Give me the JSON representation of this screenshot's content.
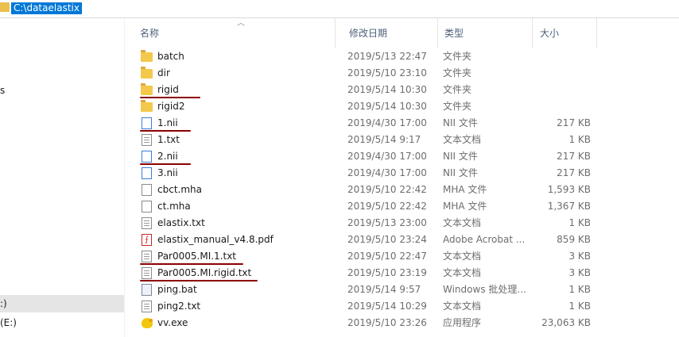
{
  "address": {
    "path": "C:\\dataelastix"
  },
  "nav": {
    "items": [
      {
        "label": "s",
        "state": "normal"
      },
      {
        "label": ":)",
        "state": "hover"
      },
      {
        "label": "(E:)",
        "state": "normal"
      }
    ]
  },
  "columns": {
    "name": "名称",
    "date": "修改日期",
    "type": "类型",
    "size": "大小"
  },
  "files": [
    {
      "name": "batch",
      "date": "2019/5/13 22:47",
      "type": "文件夹",
      "size": "",
      "icon": "folder-icon"
    },
    {
      "name": "dir",
      "date": "2019/5/10 23:10",
      "type": "文件夹",
      "size": "",
      "icon": "folder-icon"
    },
    {
      "name": "rigid",
      "date": "2019/5/14 10:30",
      "type": "文件夹",
      "size": "",
      "icon": "folder-icon"
    },
    {
      "name": "rigid2",
      "date": "2019/5/14 10:30",
      "type": "文件夹",
      "size": "",
      "icon": "folder-icon"
    },
    {
      "name": "1.nii",
      "date": "2019/4/30 17:00",
      "type": "NII 文件",
      "size": "217 KB",
      "icon": "nii-file-icon"
    },
    {
      "name": "1.txt",
      "date": "2019/5/14 9:17",
      "type": "文本文档",
      "size": "1 KB",
      "icon": "text-file-icon"
    },
    {
      "name": "2.nii",
      "date": "2019/4/30 17:00",
      "type": "NII 文件",
      "size": "217 KB",
      "icon": "nii-file-icon"
    },
    {
      "name": "3.nii",
      "date": "2019/4/30 17:00",
      "type": "NII 文件",
      "size": "217 KB",
      "icon": "nii-file-icon"
    },
    {
      "name": "cbct.mha",
      "date": "2019/5/10 22:42",
      "type": "MHA 文件",
      "size": "1,593 KB",
      "icon": "blank-file-icon"
    },
    {
      "name": "ct.mha",
      "date": "2019/5/10 22:42",
      "type": "MHA 文件",
      "size": "1,367 KB",
      "icon": "blank-file-icon"
    },
    {
      "name": "elastix.txt",
      "date": "2019/5/13 23:00",
      "type": "文本文档",
      "size": "1 KB",
      "icon": "text-file-icon"
    },
    {
      "name": "elastix_manual_v4.8.pdf",
      "date": "2019/5/10 23:24",
      "type": "Adobe Acrobat ...",
      "size": "859 KB",
      "icon": "pdf-file-icon"
    },
    {
      "name": "Par0005.MI.1.txt",
      "date": "2019/5/10 22:47",
      "type": "文本文档",
      "size": "3 KB",
      "icon": "text-file-icon"
    },
    {
      "name": "Par0005.MI.rigid.txt",
      "date": "2019/5/10 23:19",
      "type": "文本文档",
      "size": "3 KB",
      "icon": "text-file-icon"
    },
    {
      "name": "ping.bat",
      "date": "2019/5/14 9:57",
      "type": "Windows 批处理...",
      "size": "1 KB",
      "icon": "batch-file-icon"
    },
    {
      "name": "ping2.txt",
      "date": "2019/5/14 10:29",
      "type": "文本文档",
      "size": "1 KB",
      "icon": "text-file-icon"
    },
    {
      "name": "vv.exe",
      "date": "2019/5/10 23:26",
      "type": "应用程序",
      "size": "23,063 KB",
      "icon": "exe-file-icon"
    }
  ],
  "annotations": {
    "color": "#8b0000",
    "underlined_files": [
      "rigid",
      "1.nii",
      "2.nii",
      "Par0005.MI.1.txt",
      "Par0005.MI.rigid.txt"
    ]
  }
}
